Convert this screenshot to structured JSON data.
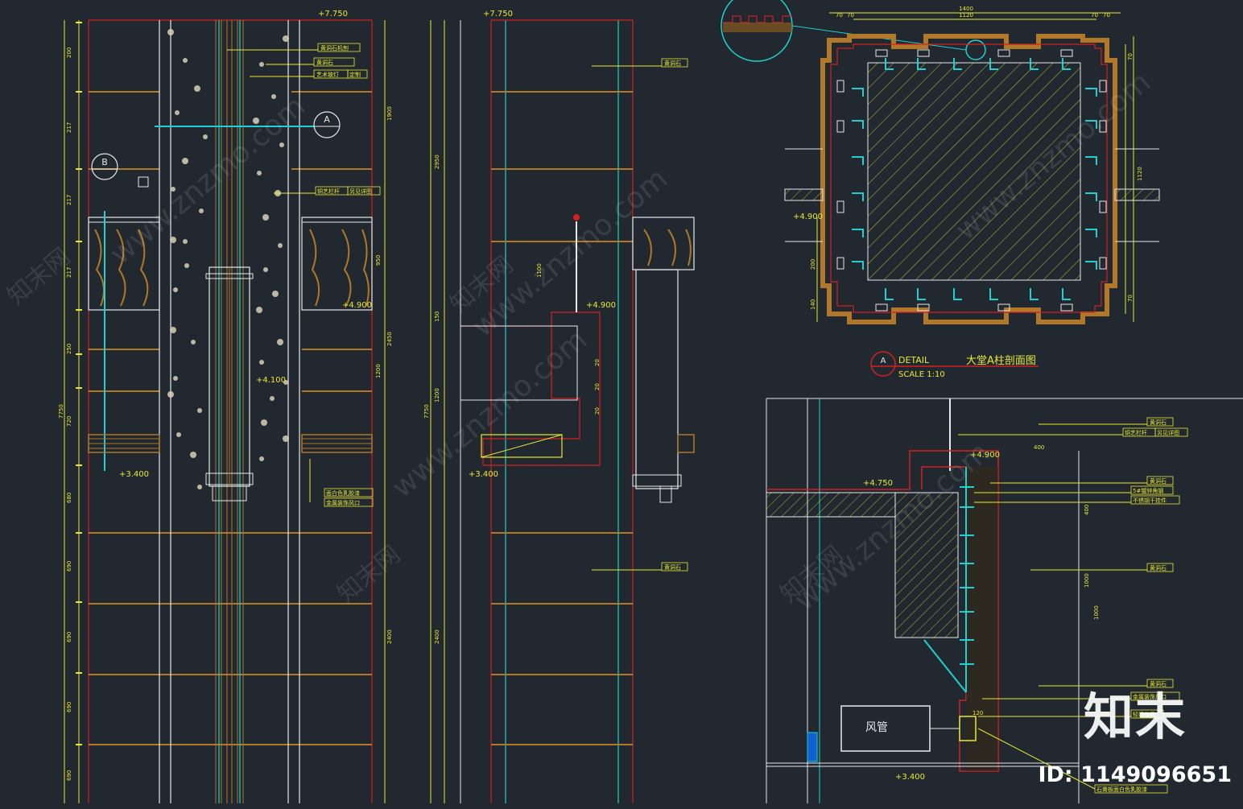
{
  "elevations": {
    "left_top": "+7.750",
    "mid_top": "+7.750",
    "left_49": "+4.900",
    "left_41": "+4.100",
    "left_34": "+3.400",
    "mid_49": "+4.900",
    "mid_34": "+3.400",
    "plan_49": "+4.900",
    "det_49": "+4.900",
    "det_4750": "+4.750",
    "det_34": "+3.400"
  },
  "left_dims": [
    "200",
    "217",
    "217",
    "217",
    "250",
    "150",
    "720",
    "680",
    "690",
    "690",
    "690",
    "690",
    "7750"
  ],
  "right_dims_left": [
    "1900",
    "950",
    "2450",
    "1200",
    "2400"
  ],
  "mid_dims": [
    "2950",
    "150",
    "1200",
    "7750",
    "2400"
  ],
  "mid_small": [
    "1100",
    "20",
    "20",
    "20"
  ],
  "markers": {
    "a": "A",
    "b": "B"
  },
  "labels_left": {
    "l1": "黄洞石机刨",
    "l2": "黄洞石",
    "l3": "艺术玻灯",
    "l4": "定制",
    "l5": "铜艺栏杆",
    "l6": "另见详图",
    "l7": "面白色乳胶漆",
    "l8": "金属装饰风口"
  },
  "labels_mid": {
    "m1": "黄洞石",
    "m2": "黄洞石"
  },
  "plan": {
    "title_tag": "DETAIL",
    "title": "大堂A柱剖面图",
    "scale": "SCALE  1:10",
    "marker": "A",
    "dims_top": [
      "1400",
      "1120",
      "70",
      "70",
      "70",
      "70"
    ],
    "dims_side": [
      "70",
      "1120",
      "70",
      "200",
      "140"
    ]
  },
  "detail": {
    "duct": "风管",
    "dims": [
      "400",
      "400",
      "1000",
      "120"
    ],
    "labels": [
      "黄洞石",
      "铜艺栏杆",
      "另见详图",
      "黄洞石",
      "5#镀锌角钢",
      "不锈钢干挂件",
      "黄洞石",
      "黄洞石",
      "金属装饰风口",
      "轻钢龙骨",
      "石膏板面白色乳胶漆"
    ]
  },
  "watermark": {
    "site": "www.znzmo.com",
    "cn": "知末网"
  },
  "brand": "知末",
  "id": "ID: 1149096651",
  "colors": {
    "bg": "#212830",
    "yellow": "#e8e830",
    "red": "#d42020",
    "cyan": "#20d0d0",
    "brown": "#b07828",
    "white": "#e8e8e8"
  }
}
